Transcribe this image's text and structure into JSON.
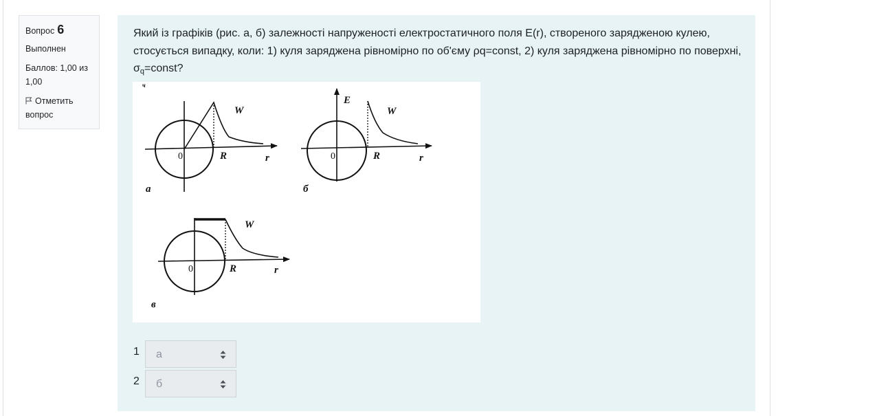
{
  "info": {
    "question_label": "Вопрос",
    "question_number": "6",
    "state": "Выполнен",
    "grade": "Баллов: 1,00 из 1,00",
    "flag_label": "Отметить вопрос"
  },
  "question": {
    "text_before_sub": "Який із графіків (рис. а, б) залежності напруженості електростатичного поля E(r), створеного зарядженою кулею, стосується випадку, коли: 1) куля заряджена рівномірно по  об'єму ρq=const, 2) куля заряджена рівномірно по поверхні, σ",
    "sub": "q",
    "text_after_sub": "=const?"
  },
  "figure": {
    "panel_a": {
      "w_label": "W",
      "zero": "0",
      "r_label": "R",
      "axis_r": "r",
      "caption": "а",
      "corner_mark": "ч"
    },
    "panel_b": {
      "e_label": "E",
      "w_label": "W",
      "zero": "0",
      "r_label": "R",
      "axis_r": "r",
      "caption": "б"
    },
    "panel_v": {
      "w_label": "W",
      "zero": "0",
      "r_label": "R",
      "axis_r": "r",
      "caption": "в"
    }
  },
  "answers": [
    {
      "number": "1",
      "value": "а"
    },
    {
      "number": "2",
      "value": "б"
    }
  ]
}
